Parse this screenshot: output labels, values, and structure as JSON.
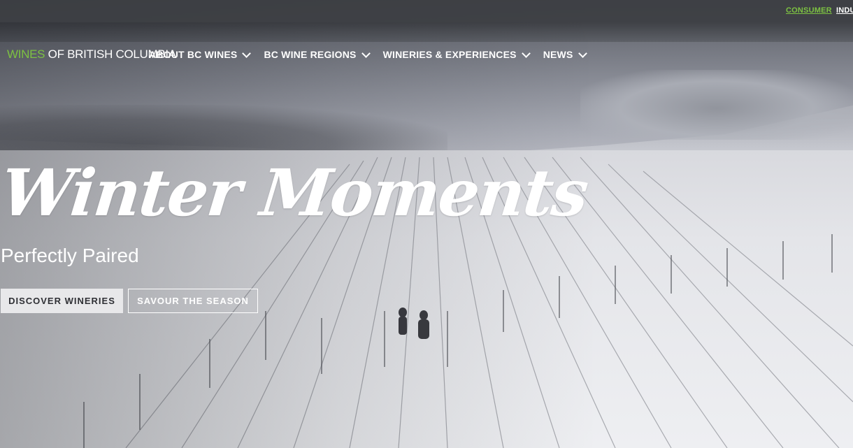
{
  "utility_bar": {
    "consumer_label": "CONSUMER",
    "industry_label": "INDU"
  },
  "logo": {
    "part1": "WINES",
    "part2": " OF BRITISH COLUMBIA"
  },
  "nav": {
    "items": [
      {
        "label": "ABOUT BC WINES"
      },
      {
        "label": "BC WINE REGIONS"
      },
      {
        "label": "WINERIES & EXPERIENCES"
      },
      {
        "label": "NEWS"
      }
    ]
  },
  "hero": {
    "title": "Winter Moments",
    "subtitle": "Perfectly Paired",
    "primary_button": "DISCOVER WINERIES",
    "secondary_button": "SAVOUR THE SEASON"
  },
  "colors": {
    "brand_green": "#7dc242",
    "utility_bar": "#3c3e42",
    "primary_button_bg": "#e8e8ea"
  }
}
